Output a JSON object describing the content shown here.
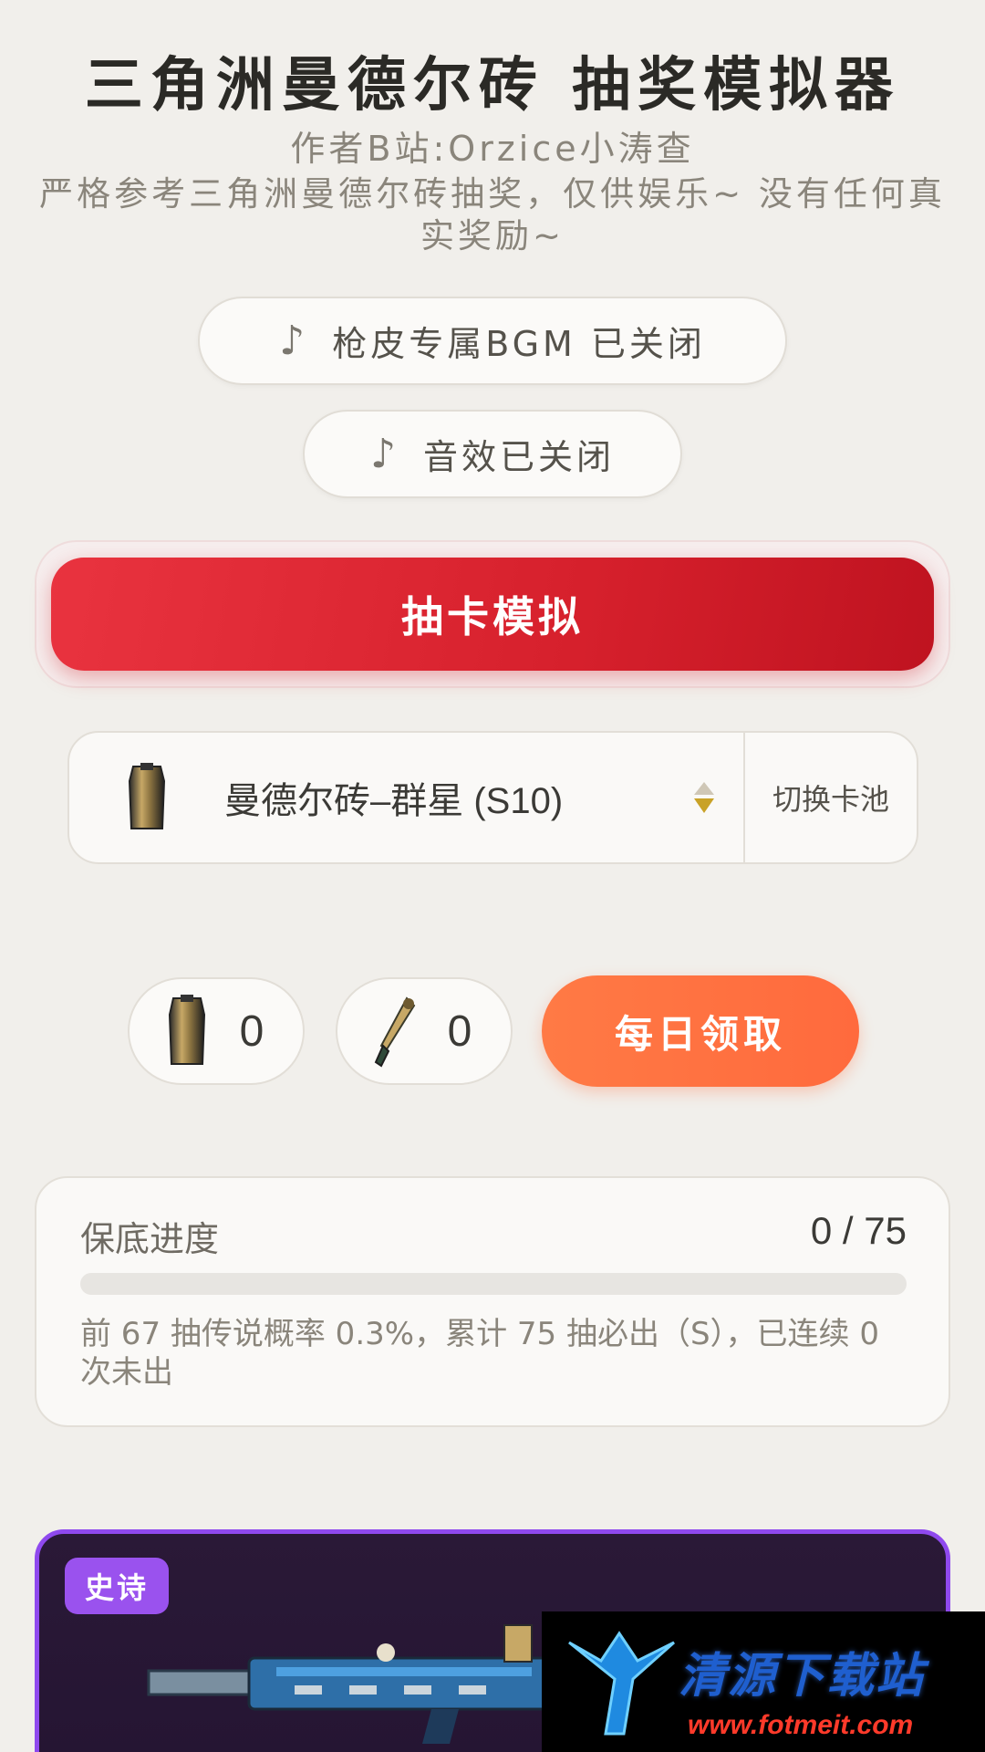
{
  "header": {
    "title": "三角洲曼德尔砖 抽奖模拟器",
    "author": "作者B站:Orzice小涛查",
    "description": "严格参考三角洲曼德尔砖抽奖，仅供娱乐~ 没有任何真实奖励~"
  },
  "toggles": {
    "bgm_icon": "♪",
    "bgm_label": "枪皮专属BGM 已关闭",
    "sfx_icon": "♪",
    "sfx_label": "音效已关闭"
  },
  "draw": {
    "label": "抽卡模拟"
  },
  "pool": {
    "selected": "曼德尔砖–群星 (S10)",
    "switch_label": "切换卡池",
    "icon": "brick-icon"
  },
  "inventory": {
    "bricks": "0",
    "keys": "0",
    "daily_label": "每日领取"
  },
  "pity": {
    "title": "保底进度",
    "count": "0 / 75",
    "progress_fraction": 0,
    "note": "前 67 抽传说概率 0.3%，累计 75 抽必出（S），已连续 0 次未出"
  },
  "result_card": {
    "rarity": "史诗",
    "border_color": "#8f49ee"
  },
  "watermark": {
    "name": "清源下载站",
    "url": "www.fotmeit.com"
  },
  "colors": {
    "draw_button": "#d6202c",
    "daily_button": "#ff6a3d",
    "epic": "#9a52ee"
  }
}
